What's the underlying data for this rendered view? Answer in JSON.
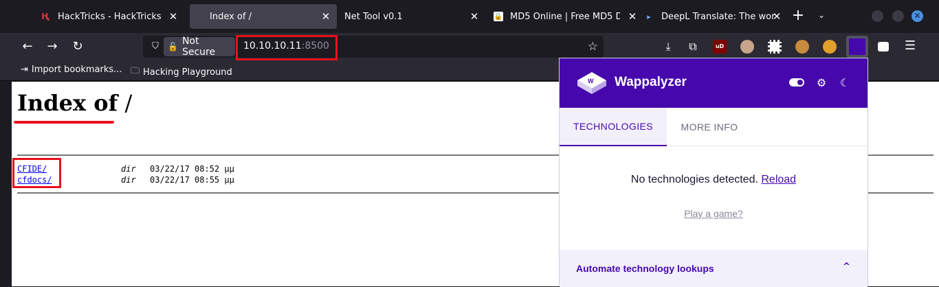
{
  "tabs": [
    {
      "title": "HackTricks - HackTricks",
      "icon": "hacktricks-icon",
      "active": false
    },
    {
      "title": "Index of /",
      "icon": "",
      "active": true
    },
    {
      "title": "Net Tool v0.1",
      "icon": "",
      "active": false
    },
    {
      "title": "MD5 Online | Free MD5 D",
      "icon": "lock-icon",
      "active": false
    },
    {
      "title": "DeepL Translate: The wor",
      "icon": "deepl-icon",
      "active": false
    }
  ],
  "navbar": {
    "security_label": "Not Secure",
    "url_host": "10.10.10.11",
    "url_port": ":8500"
  },
  "bookmarks": [
    {
      "label": "Import bookmarks...",
      "icon": "import-icon"
    },
    {
      "label": "Hacking Playground",
      "icon": "folder-icon"
    }
  ],
  "page": {
    "title_main": "Index of",
    "title_path": " /",
    "entries": [
      {
        "name": "CFIDE/",
        "type": "dir",
        "date": "03/22/17 08:52 μμ"
      },
      {
        "name": "cfdocs/",
        "type": "dir",
        "date": "03/22/17 08:55 μμ"
      }
    ]
  },
  "wappalyzer": {
    "brand": "Wappalyzer",
    "tab_technologies": "TECHNOLOGIES",
    "tab_more_info": "MORE INFO",
    "no_tech": "No technologies detected. ",
    "reload": "Reload",
    "play_game": "Play a game?",
    "automate": "Automate technology lookups",
    "accent_color": "#4608ad"
  },
  "colors": {
    "highlight": "#e8111c"
  }
}
